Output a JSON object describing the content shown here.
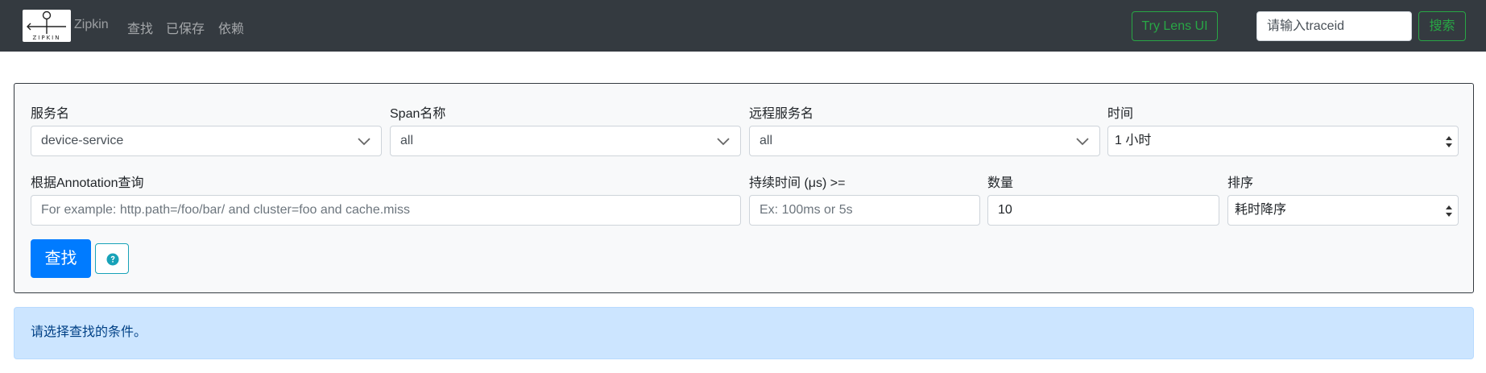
{
  "navbar": {
    "logo_text": "ZIPKIN",
    "brand": "Zipkin",
    "links": [
      {
        "label": "查找"
      },
      {
        "label": "已保存"
      },
      {
        "label": "依赖"
      }
    ],
    "lens_button": "Try Lens UI",
    "traceid_placeholder": "请输入traceid",
    "search_button": "搜索"
  },
  "form": {
    "service": {
      "label": "服务名",
      "value": "device-service"
    },
    "span": {
      "label": "Span名称",
      "value": "all"
    },
    "remote_service": {
      "label": "远程服务名",
      "value": "all"
    },
    "time": {
      "label": "时间",
      "value": "1 小时"
    },
    "annotation": {
      "label": "根据Annotation查询",
      "placeholder": "For example: http.path=/foo/bar/ and cluster=foo and cache.miss"
    },
    "duration": {
      "label": "持续时间 (μs) >=",
      "placeholder": "Ex: 100ms or 5s"
    },
    "limit": {
      "label": "数量",
      "value": "10"
    },
    "sort": {
      "label": "排序",
      "value": "耗时降序"
    },
    "find_button": "查找",
    "help_icon": "question-circle-icon"
  },
  "alert": {
    "message": "请选择查找的条件。"
  },
  "colors": {
    "navbar_bg": "#343a40",
    "primary": "#007bff",
    "success": "#28a745",
    "info": "#17a2b8",
    "alert_bg": "#cce5ff"
  }
}
